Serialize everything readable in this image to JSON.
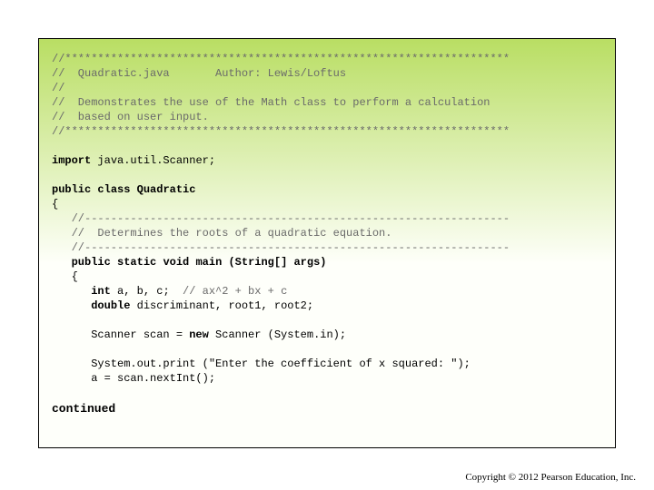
{
  "code": {
    "divider_top": "//********************************************************************",
    "header_file": "//  Quadratic.java       Author: Lewis/Loftus",
    "header_blank": "//",
    "header_desc1": "//  Demonstrates the use of the Math class to perform a calculation",
    "header_desc2": "//  based on user input.",
    "divider_bot": "//********************************************************************",
    "import_kw": "import",
    "import_rest": " java.util.Scanner;",
    "public_kw": "public",
    "class_kw": " class ",
    "classname": "Quadratic",
    "lbrace": "{",
    "inner_div_top": "   //-----------------------------------------------------------------",
    "inner_comment": "   //  Determines the roots of a quadratic equation.",
    "inner_div_bot": "   //-----------------------------------------------------------------",
    "main_sig_pre": "   ",
    "main_public": "public",
    "main_static": " static",
    "main_void": " void",
    "main_name": " main (String[] args)",
    "main_lbrace": "   {",
    "vars_pre": "      ",
    "int_kw": "int",
    "vars_rest": " a, b, c;  ",
    "vars_comment": "// ax^2 + bx + c",
    "double_kw": "double",
    "double_rest": " discriminant, root1, root2;",
    "scanner_pre": "      Scanner scan = ",
    "new_kw": "new",
    "scanner_rest": " Scanner (System.in);",
    "print_line": "      System.out.print (\"Enter the coefficient of x squared: \");",
    "read_line": "      a = scan.nextInt();"
  },
  "continued": "continued",
  "copyright": "Copyright © 2012 Pearson Education, Inc."
}
